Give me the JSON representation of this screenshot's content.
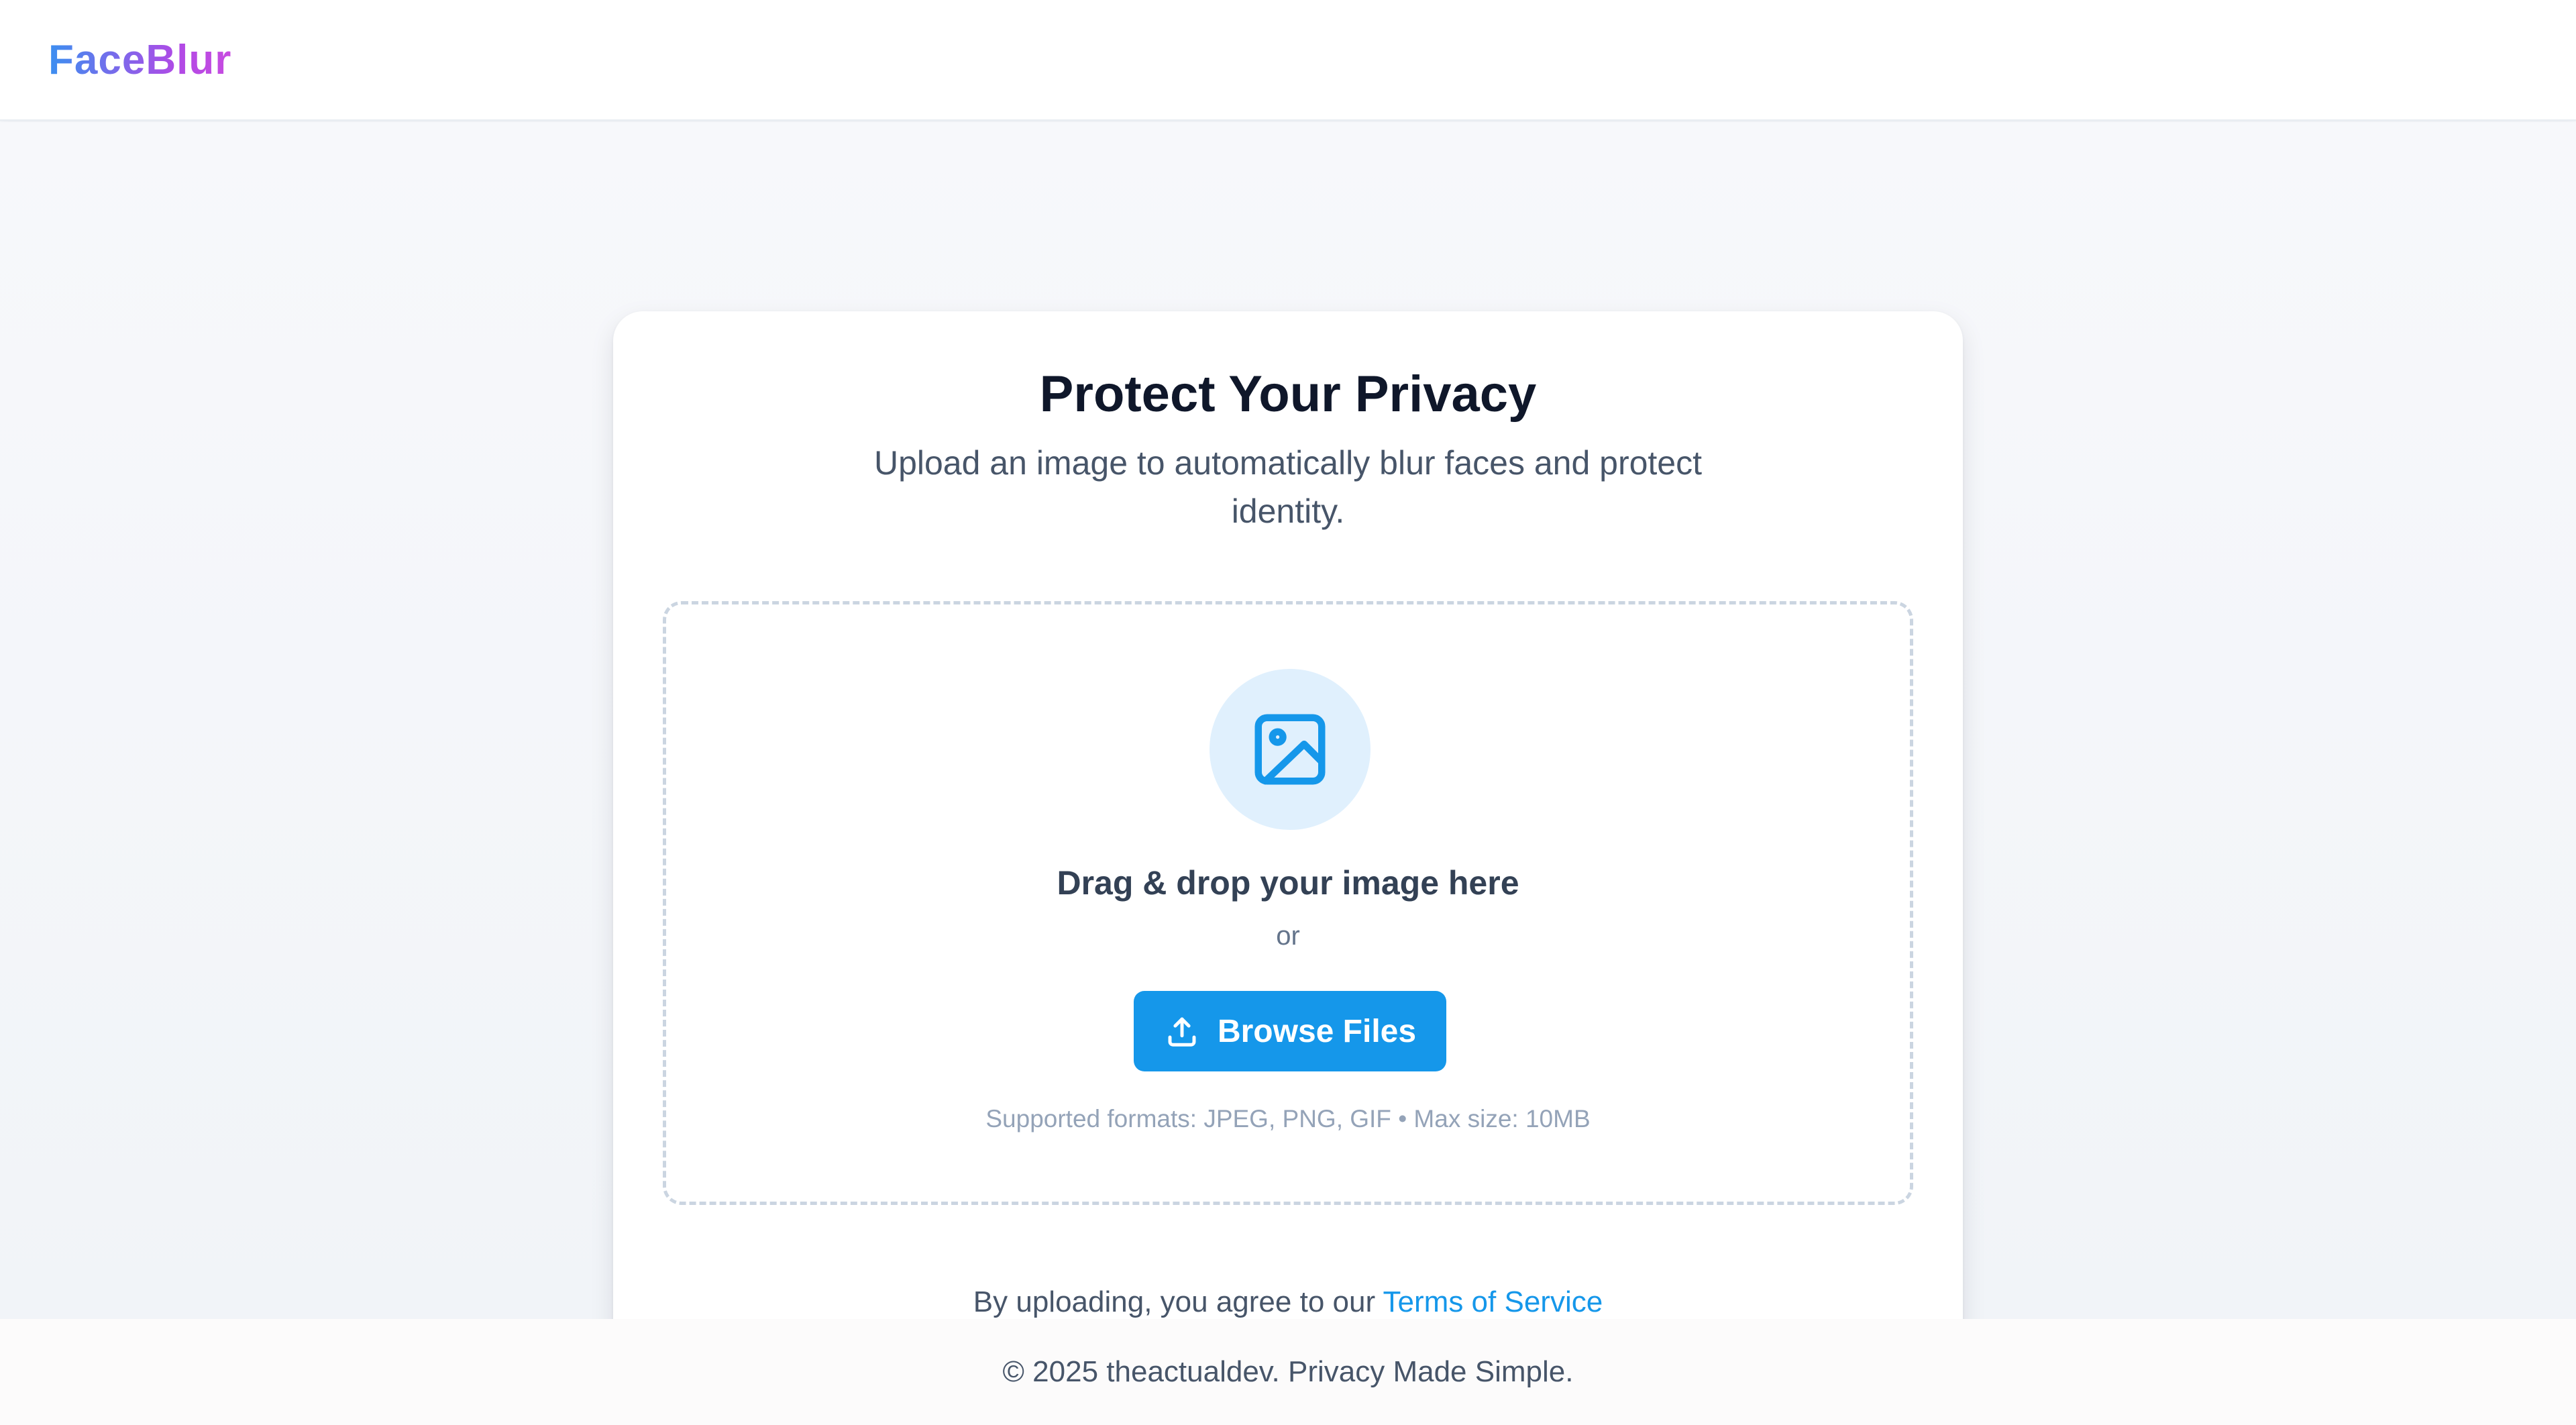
{
  "header": {
    "logo_text": "FaceBlur"
  },
  "upload_card": {
    "title": "Protect Your Privacy",
    "subtitle": "Upload an image to automatically blur faces and protect identity.",
    "dropzone": {
      "icon": "image-icon",
      "heading": "Drag & drop your image here",
      "or_text": "or",
      "browse_button": {
        "icon": "upload-icon",
        "label": "Browse Files"
      },
      "formats_note": "Supported formats: JPEG, PNG, GIF • Max size: 10MB"
    },
    "terms": {
      "prefix": "By uploading, you agree to our ",
      "link_text": "Terms of Service"
    }
  },
  "footer": {
    "text": "© 2025 theactualdev. Privacy Made Simple."
  },
  "colors": {
    "accent": "#1597ea",
    "logo_gradient_start": "#3b8ff0",
    "logo_gradient_end": "#c84be0",
    "icon_circle_bg": "#e0f0fd",
    "dropzone_border": "#cbd5e1"
  }
}
